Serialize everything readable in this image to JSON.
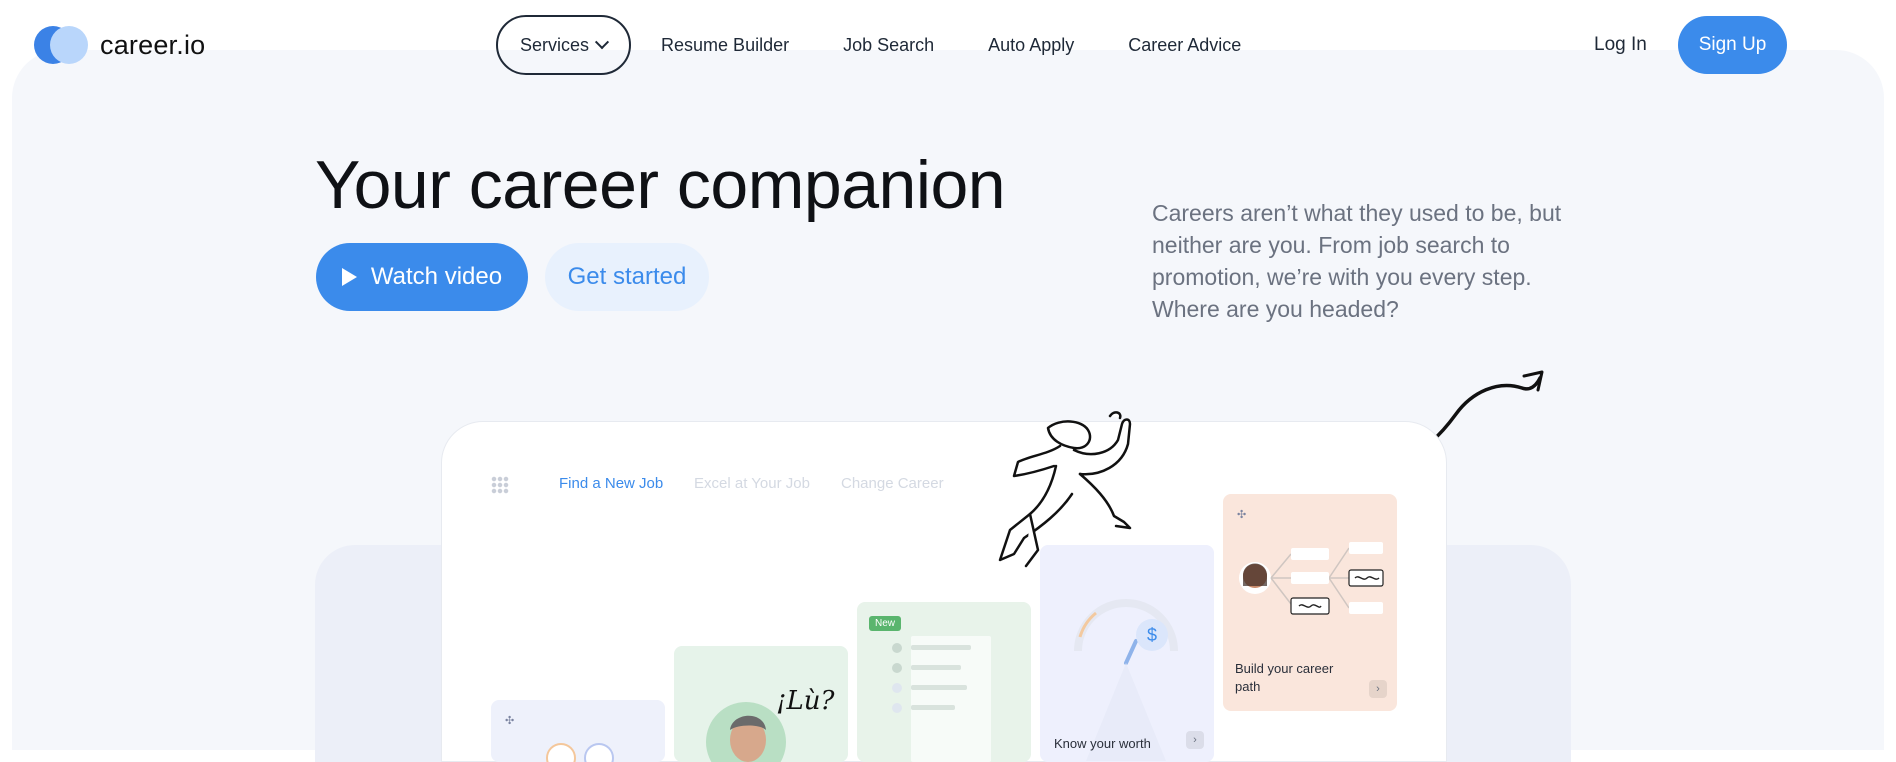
{
  "header": {
    "brand": "career.io",
    "nav": {
      "services": "Services",
      "resume_builder": "Resume Builder",
      "job_search": "Job Search",
      "auto_apply": "Auto Apply",
      "career_advice": "Career Advice"
    },
    "login": "Log In",
    "signup": "Sign Up"
  },
  "hero": {
    "title": "Your career companion",
    "watch_video": "Watch video",
    "get_started": "Get started",
    "description": "Careers aren’t what they used to be, but neither are you. From job search to promotion, we’re with you every step. Where are you headed?"
  },
  "preview": {
    "tabs": [
      "Find a New Job",
      "Excel at Your Job",
      "Change Career"
    ],
    "new_badge": "New",
    "worth_label": "Know your worth",
    "path_label": "Build your career path",
    "speech_text": "¡Lù?"
  },
  "colors": {
    "accent": "#3b8beb",
    "accent_light": "#e8f1fd",
    "background": "#f5f7fb"
  },
  "icons": [
    "logo-icon",
    "chevron-down-icon",
    "play-icon",
    "grid-icon",
    "sparkle-icon",
    "dollar-icon",
    "arrow-right-icon"
  ]
}
